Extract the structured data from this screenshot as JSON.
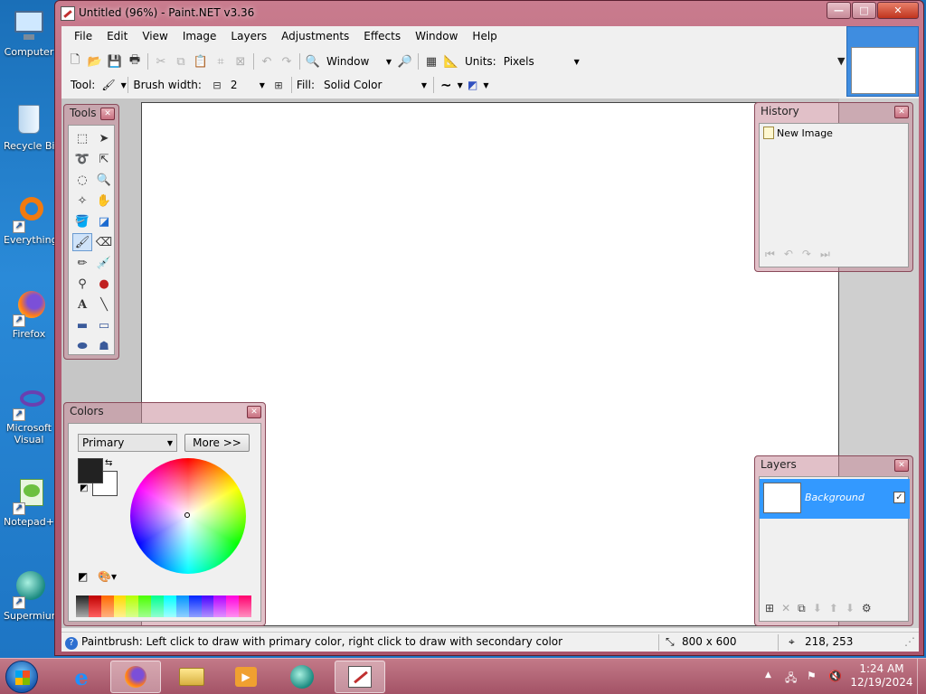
{
  "desktop": {
    "icons": [
      {
        "label": "Computer"
      },
      {
        "label": "Recycle Bin"
      },
      {
        "label": "Everything"
      },
      {
        "label": "Firefox"
      },
      {
        "label": "Microsoft Visual Studio"
      },
      {
        "label": "Notepad++"
      },
      {
        "label": "Supermium"
      }
    ]
  },
  "window": {
    "title": "Untitled (96%) - Paint.NET v3.36",
    "caption_buttons": {
      "minimize": "—",
      "maximize": "□",
      "close": "✕"
    }
  },
  "menubar": [
    "File",
    "Edit",
    "View",
    "Image",
    "Layers",
    "Adjustments",
    "Effects",
    "Window",
    "Help"
  ],
  "toolbar": {
    "zoom_value": "Window",
    "units_label": "Units:",
    "units_value": "Pixels"
  },
  "toolbar2": {
    "tool_label": "Tool:",
    "brush_width_label": "Brush width:",
    "brush_width_value": "2",
    "fill_label": "Fill:",
    "fill_value": "Solid Color"
  },
  "tools_panel": {
    "title": "Tools"
  },
  "history_panel": {
    "title": "History",
    "items": [
      "New Image"
    ]
  },
  "colors_panel": {
    "title": "Colors",
    "mode_value": "Primary",
    "more_button": "More >>",
    "primary_color": "#222222",
    "secondary_color": "#ffffff"
  },
  "layers_panel": {
    "title": "Layers",
    "layers": [
      {
        "name": "Background",
        "visible": true
      }
    ]
  },
  "status": {
    "message": "Paintbrush: Left click to draw with primary color, right click to draw with secondary color",
    "image_size": "800 x 600",
    "cursor_pos": "218, 253"
  },
  "taskbar": {
    "time": "1:24 AM",
    "date": "12/19/2024"
  },
  "colors": {
    "accent": "#3399ff",
    "selected_layer": "#3399ff",
    "window_frame": "#b65f76"
  }
}
